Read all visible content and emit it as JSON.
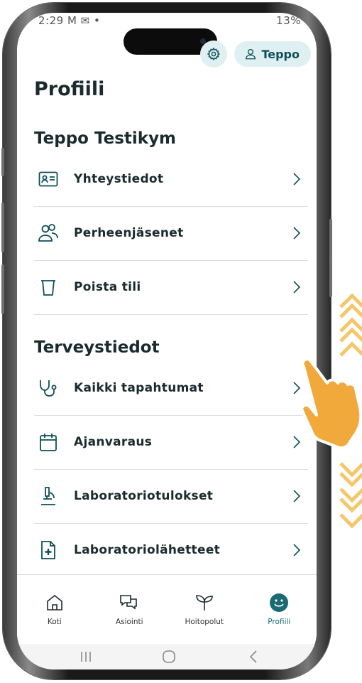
{
  "status_bar": {
    "left": "2:29 M ✉ •",
    "right": "13%"
  },
  "header": {
    "user_button_label": "Teppo",
    "settings_icon": "gear-icon"
  },
  "page_title": "Profiili",
  "profile_section": {
    "title": "Teppo Testikym",
    "items": [
      {
        "label": "Yhteystiedot",
        "icon": "contact-card-icon"
      },
      {
        "label": "Perheenjäsenet",
        "icon": "family-members-icon"
      },
      {
        "label": "Poista tili",
        "icon": "trash-icon"
      }
    ]
  },
  "health_section": {
    "title": "Terveystiedot",
    "items": [
      {
        "label": "Kaikki tapahtumat",
        "icon": "stethoscope-icon"
      },
      {
        "label": "Ajanvaraus",
        "icon": "calendar-icon"
      },
      {
        "label": "Laboratoriotulokset",
        "icon": "microscope-icon"
      },
      {
        "label": "Laboratoriolähetteet",
        "icon": "medical-document-icon"
      }
    ]
  },
  "bottom_nav": [
    {
      "label": "Koti",
      "icon": "home-icon",
      "active": false
    },
    {
      "label": "Asiointi",
      "icon": "chat-icon",
      "active": false
    },
    {
      "label": "Hoitopolut",
      "icon": "sprout-icon",
      "active": false
    },
    {
      "label": "Profiili",
      "icon": "smiley-profile-icon",
      "active": true
    }
  ],
  "colors": {
    "accent": "#1b6b73",
    "chip_background": "#dff0f2",
    "text": "#1b2b2d",
    "gesture_orange": "#f2a93b"
  }
}
